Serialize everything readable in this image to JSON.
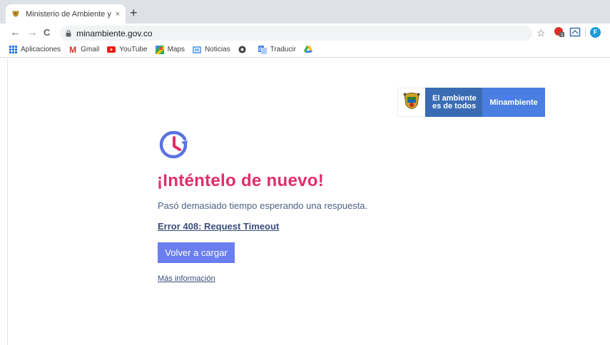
{
  "browser": {
    "tab": {
      "title": "Ministerio de Ambiente y Deso",
      "close_glyph": "×",
      "favicon": "colombia-seal-icon"
    },
    "new_tab_glyph": "+",
    "nav": {
      "back": "←",
      "forward": "→",
      "reload": "C"
    },
    "url": "minambiente.gov.co",
    "star": "☆",
    "menu": "⋮",
    "profile_initial": "F",
    "bookmarks": [
      {
        "label": "Aplicaciones",
        "icon": "apps-grid-icon"
      },
      {
        "label": "Gmail",
        "icon": "gmail-icon"
      },
      {
        "label": "YouTube",
        "icon": "youtube-icon"
      },
      {
        "label": "Maps",
        "icon": "maps-icon"
      },
      {
        "label": "Noticias",
        "icon": "news-icon"
      },
      {
        "label": "",
        "icon": "globe-icon"
      },
      {
        "label": "Traducir",
        "icon": "translate-icon"
      },
      {
        "label": "",
        "icon": "drive-icon"
      }
    ]
  },
  "logo": {
    "slogan_line1": "El ambiente",
    "slogan_line2": "es de todos",
    "brand": "Minambiente"
  },
  "error": {
    "heading": "¡Inténtelo de nuevo!",
    "message": "Pasó demasiado tiempo esperando una respuesta.",
    "code_link": "Error 408: Request Timeout",
    "reload_button": "Volver a cargar",
    "more_info": "Más información"
  },
  "colors": {
    "accent_pink": "#e12d6a",
    "accent_blue": "#4a7ee0",
    "button_blue": "#6b7ef0",
    "text_blue": "#4f6285"
  }
}
